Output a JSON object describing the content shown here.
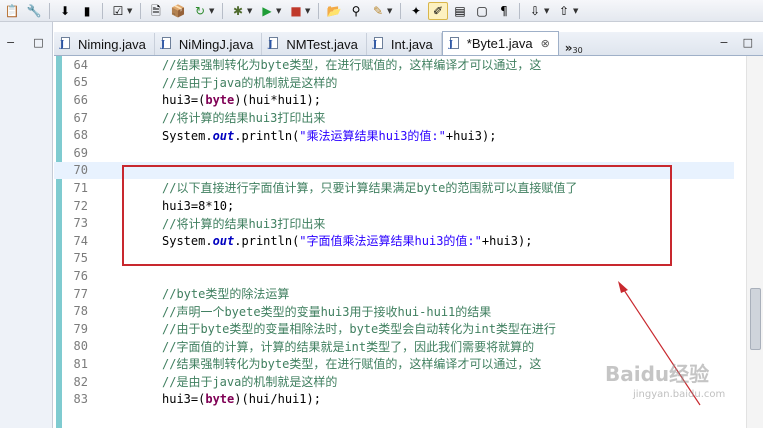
{
  "toolbar": {
    "icons": [
      "paste-icon",
      "tools-icon",
      "save-icon",
      "battery-icon",
      "checkbox-icon",
      "new-file-icon",
      "package-icon",
      "refresh-icon",
      "debug-bug-icon",
      "run-icon",
      "stop-icon",
      "folder-open-icon",
      "link-icon",
      "wand-icon",
      "pin-icon",
      "pen-icon",
      "document-icon",
      "page-icon",
      "paragraph-icon",
      "arrow-down-icon",
      "arrow-up-icon"
    ]
  },
  "left_panel": {
    "minimize": "−",
    "maximize": "□"
  },
  "tabs": [
    {
      "label": "Niming.java"
    },
    {
      "label": "NiMingJ.java"
    },
    {
      "label": "NMTest.java"
    },
    {
      "label": "Int.java"
    },
    {
      "label": "*Byte1.java",
      "active": true
    }
  ],
  "tab_close": "⊗",
  "tab_overflow": {
    "chevron": "»",
    "count": "30"
  },
  "editor_controls": {
    "minimize": "−",
    "maximize": "□"
  },
  "code": [
    {
      "num": "64",
      "tokens": [
        {
          "t": "cmt",
          "v": "//结果强制转化为byte类型，在进行赋值的，这样编译才可以通过，这"
        }
      ]
    },
    {
      "num": "65",
      "tokens": [
        {
          "t": "cmt",
          "v": "//是由于java的机制就是这样的"
        }
      ]
    },
    {
      "num": "66",
      "tokens": [
        {
          "t": "plain",
          "v": "hui3=("
        },
        {
          "t": "kw",
          "v": "byte"
        },
        {
          "t": "plain",
          "v": ")(hui*hui1);"
        }
      ]
    },
    {
      "num": "67",
      "tokens": [
        {
          "t": "cmt",
          "v": "//将计算的结果hui3打印出来"
        }
      ]
    },
    {
      "num": "68",
      "tokens": [
        {
          "t": "plain",
          "v": "System."
        },
        {
          "t": "stat",
          "v": "out"
        },
        {
          "t": "plain",
          "v": ".println("
        },
        {
          "t": "str",
          "v": "\"乘法运算结果hui3的值:\""
        },
        {
          "t": "plain",
          "v": "+hui3);"
        }
      ]
    },
    {
      "num": "69",
      "tokens": []
    },
    {
      "num": "70",
      "tokens": [],
      "highlight": true
    },
    {
      "num": "71",
      "tokens": [
        {
          "t": "cmt",
          "v": "//以下直接进行字面值计算，只要计算结果满足byte的范围就可以直接赋值了"
        }
      ]
    },
    {
      "num": "72",
      "tokens": [
        {
          "t": "plain",
          "v": "hui3=8*10;"
        }
      ]
    },
    {
      "num": "73",
      "tokens": [
        {
          "t": "cmt",
          "v": "//将计算的结果hui3打印出来"
        }
      ]
    },
    {
      "num": "74",
      "tokens": [
        {
          "t": "plain",
          "v": "System."
        },
        {
          "t": "stat",
          "v": "out"
        },
        {
          "t": "plain",
          "v": ".println("
        },
        {
          "t": "str",
          "v": "\"字面值乘法运算结果hui3的值:\""
        },
        {
          "t": "plain",
          "v": "+hui3);"
        }
      ]
    },
    {
      "num": "75",
      "tokens": []
    },
    {
      "num": "76",
      "tokens": []
    },
    {
      "num": "77",
      "tokens": [
        {
          "t": "cmt",
          "v": "//byte类型的除法运算"
        }
      ]
    },
    {
      "num": "78",
      "tokens": [
        {
          "t": "cmt",
          "v": "//声明一个byete类型的变量hui3用于接收hui-hui1的结果"
        }
      ]
    },
    {
      "num": "79",
      "tokens": [
        {
          "t": "cmt",
          "v": "//由于byte类型的变量相除法时，byte类型会自动转化为int类型在进行"
        }
      ]
    },
    {
      "num": "80",
      "tokens": [
        {
          "t": "cmt",
          "v": "//字面值的计算，计算的结果就是int类型了，因此我们需要将就算的"
        }
      ]
    },
    {
      "num": "81",
      "tokens": [
        {
          "t": "cmt",
          "v": "//结果强制转化为byte类型，在进行赋值的，这样编译才可以通过，这"
        }
      ]
    },
    {
      "num": "82",
      "tokens": [
        {
          "t": "cmt",
          "v": "//是由于java的机制就是这样的"
        }
      ]
    },
    {
      "num": "83",
      "tokens": [
        {
          "t": "plain",
          "v": "hui3=("
        },
        {
          "t": "kw",
          "v": "byte"
        },
        {
          "t": "plain",
          "v": ")(hui/hui1);"
        }
      ]
    }
  ],
  "watermark": {
    "logo": "Baidu经验",
    "url": "jingyan.baidu.com"
  },
  "colors": {
    "annotation_red": "#c8282e",
    "ruler": "#7fcbd0"
  }
}
